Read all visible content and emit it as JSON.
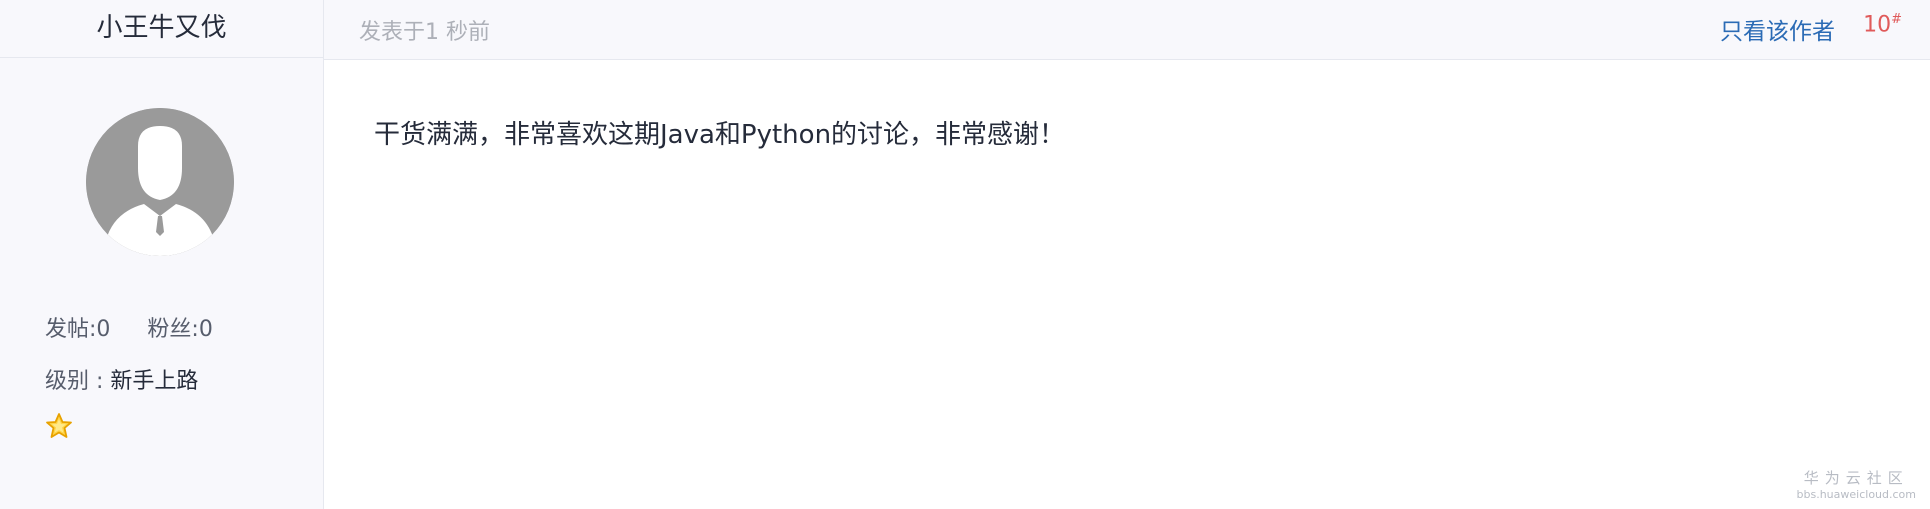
{
  "author": {
    "name": "小王牛又伐",
    "avatar_icon": "default-user-avatar-icon",
    "posts_label": "发帖:0",
    "fans_label": "粉丝:0",
    "level_label": "级别 : ",
    "level_value": "新手上路",
    "level_badge_icon": "star-icon"
  },
  "post": {
    "time": "发表于1 秒前",
    "only_author": "只看该作者",
    "floor_number": "10",
    "floor_mark": "#",
    "content": "干货满满，非常喜欢这期Java和Python的讨论，非常感谢！"
  },
  "watermark": {
    "title": "华为云社区",
    "url": "bbs.huaweicloud.com"
  },
  "colors": {
    "sidebar_bg": "#f8f8fc",
    "link": "#2b6bb5",
    "floor": "#e05a5a",
    "muted": "#adb0b8"
  }
}
